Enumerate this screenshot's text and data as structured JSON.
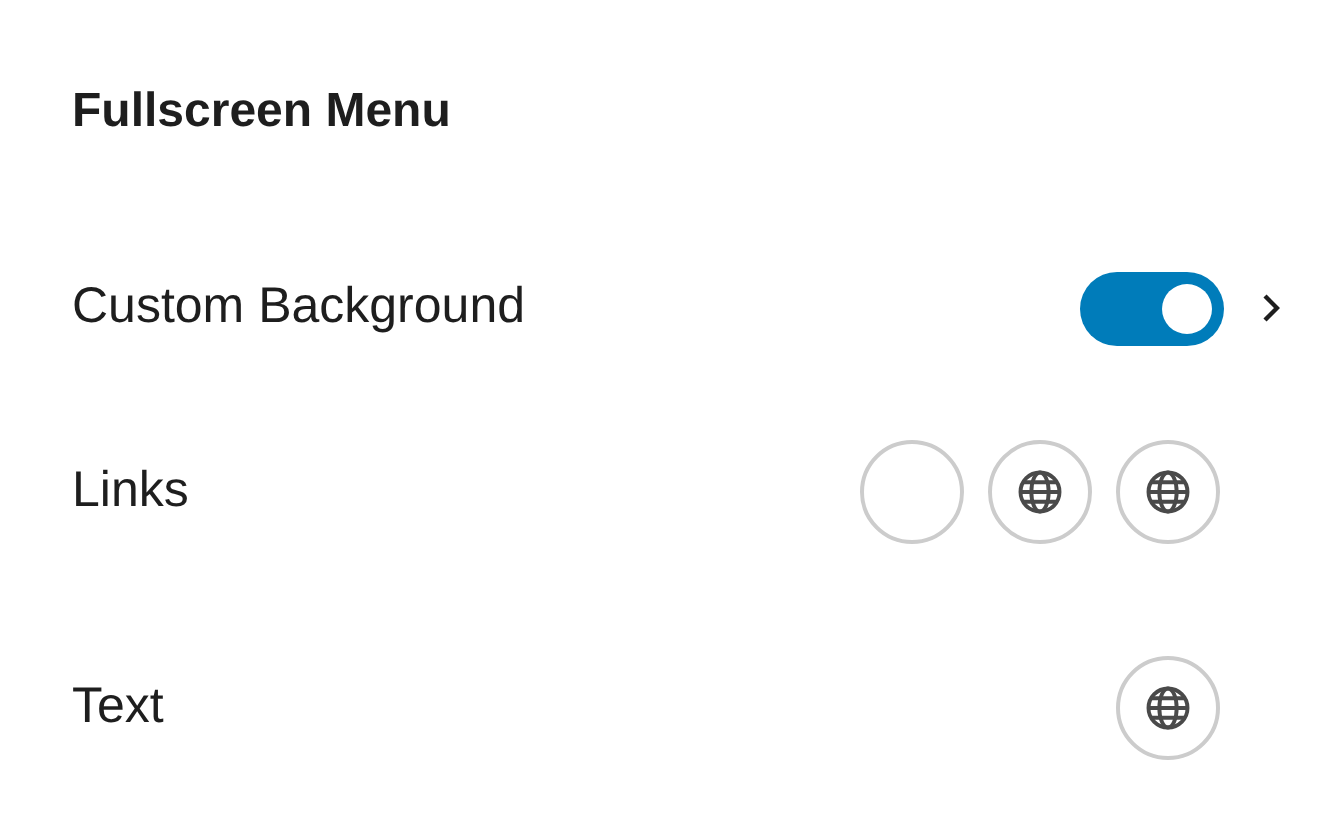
{
  "title": "Fullscreen Menu",
  "rows": [
    {
      "kind": "toggle",
      "label": "Custom Background",
      "on": true
    },
    {
      "kind": "swatches",
      "label": "Links",
      "swatches": [
        {
          "kind": "empty"
        },
        {
          "kind": "global"
        },
        {
          "kind": "global"
        }
      ]
    },
    {
      "kind": "swatches",
      "label": "Text",
      "swatches": [
        {
          "kind": "global"
        }
      ]
    }
  ]
}
